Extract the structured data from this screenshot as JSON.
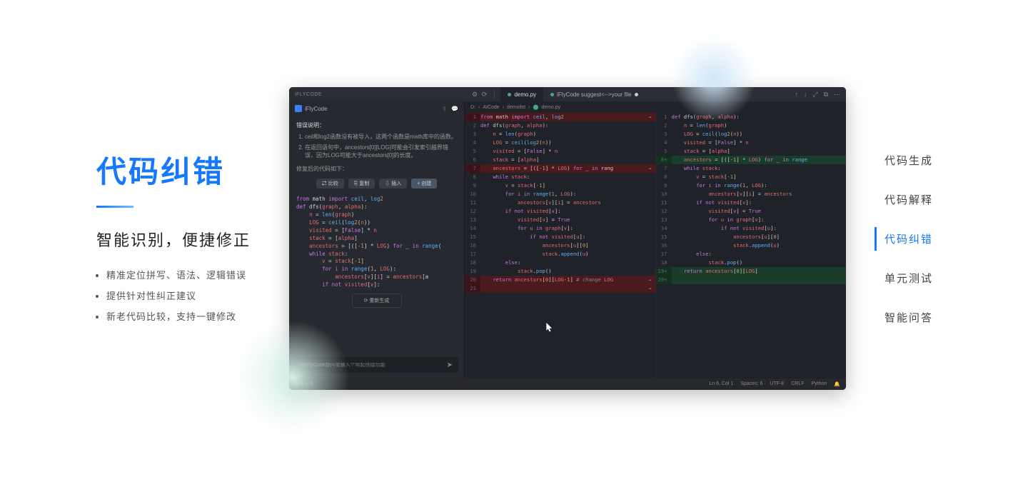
{
  "left": {
    "title": "代码纠错",
    "subtitle": "智能识别，便捷修正",
    "bullets": [
      "精准定位拼写、语法、逻辑错误",
      "提供针对性纠正建议",
      "新老代码比较，支持一键修改"
    ]
  },
  "nav": {
    "items": [
      "代码生成",
      "代码解释",
      "代码纠错",
      "单元测试",
      "智能问答"
    ],
    "active_index": 2
  },
  "ide": {
    "brand": "iFLYCODE",
    "sidebar_brand": "iFlyCode",
    "tabs": [
      {
        "label": "demo.py",
        "active": true
      },
      {
        "label": "iFlyCode suggest<-->your file",
        "dirty": true
      }
    ],
    "breadcrumbs": [
      "D:",
      "AICode",
      "demolist",
      "demo.py"
    ],
    "chat": {
      "section_label": "错误说明：",
      "issues": [
        "ceil和log2函数没有被导入，这两个函数是math库中的函数。",
        "在返回语句中，ancestors[0][LOG]可能会引发索引越界错误，因为LOG可能大于ancestors[0]的长度。"
      ],
      "after_fix_label": "修复后的代码如下：",
      "buttons": [
        "⇄ 比较",
        "⎘ 复制",
        "⇩ 插入",
        "+ 创建"
      ],
      "regen": "⟳ 重新生成",
      "input_placeholder": "向iFlyCode提问或输入\"/\"帮起快捷功能"
    },
    "code_snippet": [
      {
        "t": "from math import ceil, log2",
        "c": "kw"
      },
      {
        "t": "def dfs(graph, alpha):",
        "c": ""
      },
      {
        "t": "    n = len(graph)",
        "c": ""
      },
      {
        "t": "    LOG = ceil(log2(n))",
        "c": ""
      },
      {
        "t": "    visited = [False] * n",
        "c": ""
      },
      {
        "t": "    stack = [alpha]",
        "c": ""
      },
      {
        "t": "    ancestors = [([-1] * LOG) for _ in range(",
        "c": ""
      },
      {
        "t": "    while stack:",
        "c": ""
      },
      {
        "t": "        v = stack[-1]",
        "c": ""
      },
      {
        "t": "        for i in range(1, LOG):",
        "c": ""
      },
      {
        "t": "            ancestors[v][i] = ancestors[a",
        "c": ""
      },
      {
        "t": "        if not visited[v]:",
        "c": ""
      }
    ],
    "diff_left": [
      {
        "n": 1,
        "t": "from math import ceil, log2",
        "cls": "removed",
        "arrow": "→"
      },
      {
        "n": 2,
        "t": "def dfs(graph, alpha):",
        "cls": ""
      },
      {
        "n": 3,
        "t": "    n = len(graph)",
        "cls": ""
      },
      {
        "n": 4,
        "t": "    LOG = ceil(log2(n))",
        "cls": ""
      },
      {
        "n": 5,
        "t": "    visited = [False] * n",
        "cls": ""
      },
      {
        "n": 6,
        "t": "    stack = [alpha]",
        "cls": ""
      },
      {
        "n": 7,
        "t": "    ancestors = [([-1] * LOG) for _ in rang",
        "cls": "removed",
        "arrow": "→"
      },
      {
        "n": 8,
        "t": "    while stack:",
        "cls": ""
      },
      {
        "n": 9,
        "t": "        v = stack[-1]",
        "cls": ""
      },
      {
        "n": 10,
        "t": "        for i in range(1, LOG):",
        "cls": ""
      },
      {
        "n": 11,
        "t": "            ancestors[v][i] = ancestors",
        "cls": ""
      },
      {
        "n": 12,
        "t": "        if not visited[v]:",
        "cls": ""
      },
      {
        "n": 13,
        "t": "            visited[v] = True",
        "cls": ""
      },
      {
        "n": 14,
        "t": "            for u in graph[v]:",
        "cls": ""
      },
      {
        "n": 15,
        "t": "                if not visited[u]:",
        "cls": ""
      },
      {
        "n": 16,
        "t": "                    ancestors[u][0]",
        "cls": ""
      },
      {
        "n": 17,
        "t": "                    stack.append(u)",
        "cls": ""
      },
      {
        "n": 18,
        "t": "        else:",
        "cls": ""
      },
      {
        "n": 19,
        "t": "            stack.pop()",
        "cls": ""
      },
      {
        "n": 20,
        "t": "    return ancestors[0][LOG-1] # change LOG",
        "cls": "removed",
        "arrow": "→"
      },
      {
        "n": 21,
        "t": "",
        "cls": "removed",
        "arrow": "→"
      }
    ],
    "diff_right": [
      {
        "n": "",
        "t": "",
        "cls": ""
      },
      {
        "n": 1,
        "t": "def dfs(graph, alpha):",
        "cls": ""
      },
      {
        "n": 2,
        "t": "    n = len(graph)",
        "cls": ""
      },
      {
        "n": 3,
        "t": "    LOG = ceil(log2(n))",
        "cls": ""
      },
      {
        "n": 4,
        "t": "    visited = [False] * n",
        "cls": ""
      },
      {
        "n": 5,
        "t": "    stack = [alpha]",
        "cls": ""
      },
      {
        "n": "6+",
        "t": "    ancestors = [([-1] * LOG) for _ in range",
        "cls": "added"
      },
      {
        "n": 7,
        "t": "    while stack:",
        "cls": ""
      },
      {
        "n": 8,
        "t": "        v = stack[-1]",
        "cls": ""
      },
      {
        "n": 9,
        "t": "        for i in range(1, LOG):",
        "cls": ""
      },
      {
        "n": 10,
        "t": "            ancestors[v][i] = ancestors",
        "cls": ""
      },
      {
        "n": 11,
        "t": "        if not visited[v]:",
        "cls": ""
      },
      {
        "n": 12,
        "t": "            visited[v] = True",
        "cls": ""
      },
      {
        "n": 13,
        "t": "            for u in graph[v]:",
        "cls": ""
      },
      {
        "n": 14,
        "t": "                if not visited[u]:",
        "cls": ""
      },
      {
        "n": 15,
        "t": "                    ancestors[u][0]",
        "cls": ""
      },
      {
        "n": 16,
        "t": "                    stack.append(u)",
        "cls": ""
      },
      {
        "n": 17,
        "t": "        else:",
        "cls": ""
      },
      {
        "n": 18,
        "t": "            stack.pop()",
        "cls": ""
      },
      {
        "n": "19+",
        "t": "    return ancestors[0][LOG]",
        "cls": "added"
      },
      {
        "n": "20+",
        "t": "",
        "cls": "added"
      }
    ],
    "status": {
      "left": "⊘ 0 ⚠ 0",
      "right": [
        "Ln 6, Col 1",
        "Spaces: 6",
        "UTF-8",
        "CRLF",
        "Python",
        "🔔"
      ]
    },
    "top_icons": [
      "↑",
      "↓",
      "⤢",
      "⧉",
      "⋯"
    ],
    "left_top_icons": [
      "⚙",
      "⟳",
      "⋮"
    ]
  }
}
